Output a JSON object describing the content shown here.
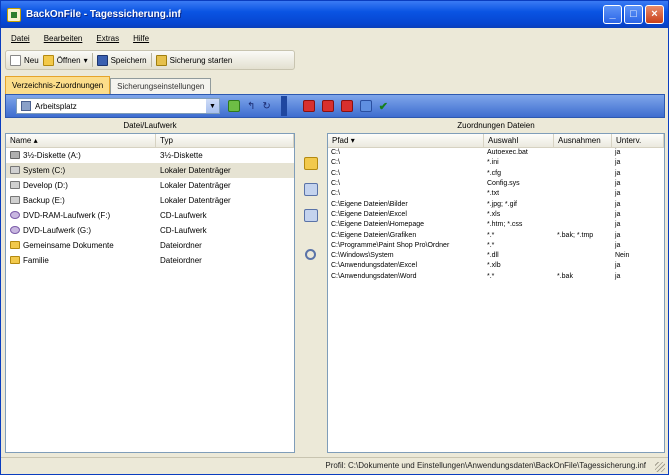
{
  "window": {
    "title": "BackOnFile - Tagessicherung.inf",
    "controls": [
      "_",
      "□",
      "×"
    ]
  },
  "menu": [
    "Datei",
    "Bearbeiten",
    "Extras",
    "Hilfe"
  ],
  "toolbar": {
    "new_label": "Neu",
    "open_label": "Öffnen",
    "save_label": "Speichern",
    "exec_label": "Sicherung starten"
  },
  "tabs": [
    "Verzeichnis-Zuordnungen",
    "Sicherungseinstellungen"
  ],
  "band": {
    "combo_value": "Arbeitsplatz"
  },
  "left_panel": {
    "caption": "Datei/Laufwerk",
    "columns": [
      "Name",
      "Typ"
    ],
    "rows": [
      {
        "name": "3½-Diskette (A:)",
        "type": "3½-Diskette",
        "icon": "floppy"
      },
      {
        "name": "System (C:)",
        "type": "Lokaler Datenträger",
        "icon": "hdd"
      },
      {
        "name": "Develop (D:)",
        "type": "Lokaler Datenträger",
        "icon": "hdd"
      },
      {
        "name": "Backup (E:)",
        "type": "Lokaler Datenträger",
        "icon": "hdd"
      },
      {
        "name": "DVD-RAM-Laufwerk (F:)",
        "type": "CD-Laufwerk",
        "icon": "cd"
      },
      {
        "name": "DVD-Laufwerk (G:)",
        "type": "CD-Laufwerk",
        "icon": "cd"
      },
      {
        "name": "Gemeinsame Dokumente",
        "type": "Dateiordner",
        "icon": "folder"
      },
      {
        "name": "Familie",
        "type": "Dateiordner",
        "icon": "folder"
      }
    ]
  },
  "right_panel": {
    "caption": "Zuordnungen Dateien",
    "columns": [
      "Pfad",
      "Auswahl",
      "Ausnahmen",
      "Unterv."
    ],
    "rows": [
      {
        "path": "C:\\",
        "sel": "Autoexec.bat",
        "exc": "",
        "sub": "ja"
      },
      {
        "path": "C:\\",
        "sel": "*.ini",
        "exc": "",
        "sub": "ja"
      },
      {
        "path": "C:\\",
        "sel": "*.cfg",
        "exc": "",
        "sub": "ja"
      },
      {
        "path": "C:\\",
        "sel": "Config.sys",
        "exc": "",
        "sub": "ja"
      },
      {
        "path": "C:\\",
        "sel": "*.txt",
        "exc": "",
        "sub": "ja"
      },
      {
        "path": "C:\\Eigene Dateien\\Bilder",
        "sel": "*.jpg; *.gif",
        "exc": "",
        "sub": "ja"
      },
      {
        "path": "C:\\Eigene Dateien\\Excel",
        "sel": "*.xls",
        "exc": "",
        "sub": "ja"
      },
      {
        "path": "C:\\Eigene Dateien\\Homepage",
        "sel": "*.htm; *.css",
        "exc": "",
        "sub": "ja"
      },
      {
        "path": "C:\\Eigene Dateien\\Grafiken",
        "sel": "*.*",
        "exc": "*.bak; *.tmp",
        "sub": "ja"
      },
      {
        "path": "C:\\Programme\\Paint Shop Pro\\Ordner",
        "sel": "*.*",
        "exc": "",
        "sub": "ja"
      },
      {
        "path": "C:\\Windows\\System",
        "sel": "*.dll",
        "exc": "",
        "sub": "Nein"
      },
      {
        "path": "C:\\Anwendungsdaten\\Excel",
        "sel": "*.xlb",
        "exc": "",
        "sub": "ja"
      },
      {
        "path": "C:\\Anwendungsdaten\\Word",
        "sel": "*.*",
        "exc": "*.bak",
        "sub": "ja"
      }
    ]
  },
  "status": {
    "text": "Profil: C:\\Dokumente und Einstellungen\\Anwendungsdaten\\BackOnFile\\Tagessicherung.inf"
  }
}
